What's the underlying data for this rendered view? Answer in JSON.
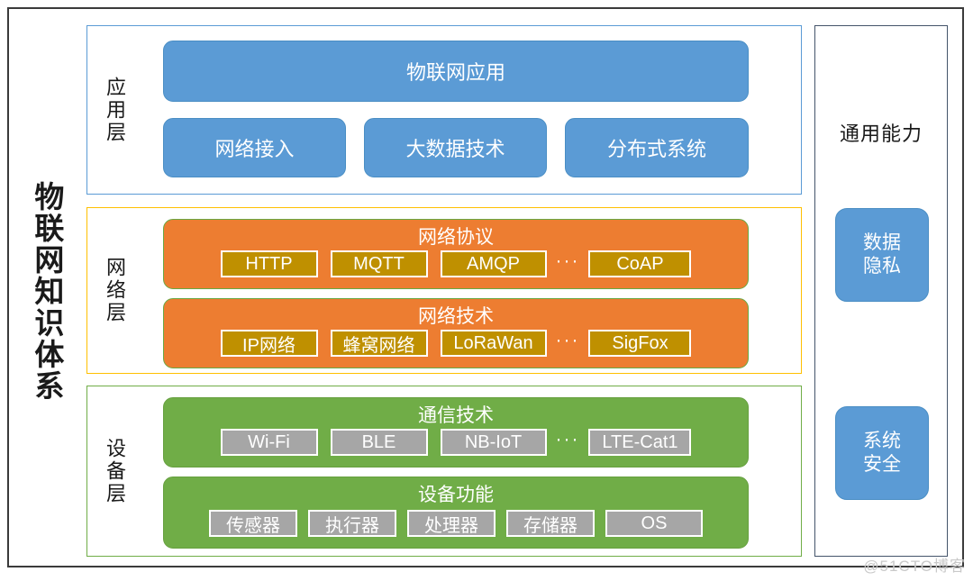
{
  "diagram": {
    "title": "物联网知识体系",
    "watermark": "@51CTO博客"
  },
  "layers": [
    {
      "id": "app",
      "label": "应用层",
      "border_color": "#5B9BD5",
      "blocks": [
        {
          "kind": "solid",
          "color": "#5B9BD5",
          "title": "物联网应用"
        },
        {
          "kind": "solid",
          "color": "#5B9BD5",
          "title": "网络接入"
        },
        {
          "kind": "solid",
          "color": "#5B9BD5",
          "title": "大数据技术"
        },
        {
          "kind": "solid",
          "color": "#5B9BD5",
          "title": "分布式系统"
        }
      ]
    },
    {
      "id": "net",
      "label": "网络层",
      "border_color": "#FFC000",
      "groups": [
        {
          "title": "网络协议",
          "color": "#ED7D31",
          "chip_color": "#BF9000",
          "chips": [
            "HTTP",
            "MQTT",
            "AMQP",
            "···",
            "CoAP"
          ]
        },
        {
          "title": "网络技术",
          "color": "#ED7D31",
          "chip_color": "#BF9000",
          "chips": [
            "IP网络",
            "蜂窝网络",
            "LoRaWan",
            "···",
            "SigFox"
          ]
        }
      ]
    },
    {
      "id": "dev",
      "label": "设备层",
      "border_color": "#70AD47",
      "groups": [
        {
          "title": "通信技术",
          "color": "#70AD47",
          "chip_color": "#A6A6A6",
          "chips": [
            "Wi-Fi",
            "BLE",
            "NB-IoT",
            "···",
            "LTE-Cat1"
          ]
        },
        {
          "title": "设备功能",
          "color": "#70AD47",
          "chip_color": "#A6A6A6",
          "chips": [
            "传感器",
            "执行器",
            "处理器",
            "存储器",
            "OS"
          ]
        }
      ]
    }
  ],
  "capability": {
    "title": "通用能力",
    "border_color": "#44546A",
    "boxes": [
      {
        "lines": [
          "数据",
          "隐私"
        ],
        "color": "#5B9BD5"
      },
      {
        "lines": [
          "系统",
          "安全"
        ],
        "color": "#5B9BD5"
      }
    ]
  }
}
